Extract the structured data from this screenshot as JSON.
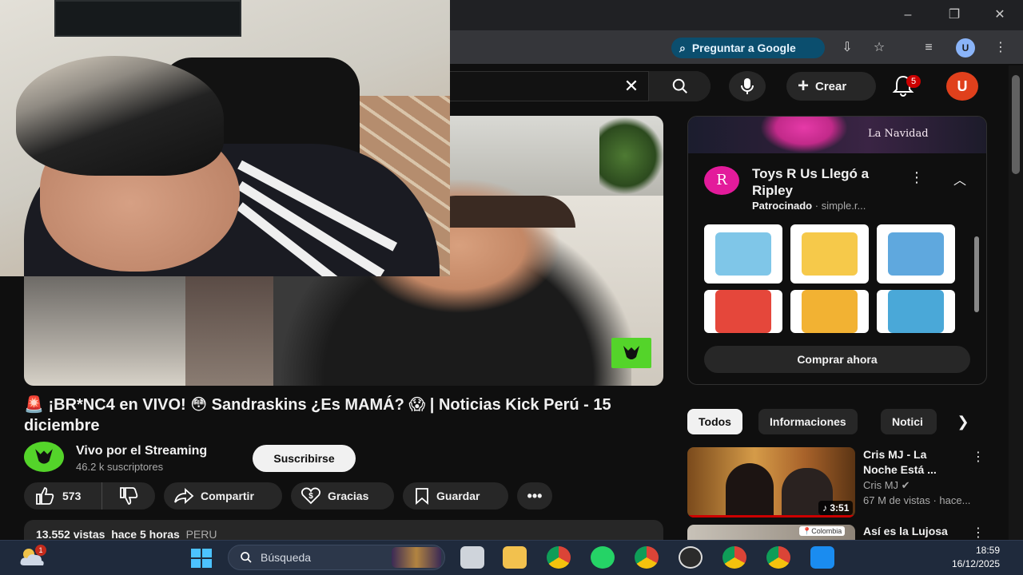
{
  "browser": {
    "omnibox_button": "Preguntar a Google",
    "profile_initial": "U",
    "icons": [
      "minimize-icon",
      "maximize-icon",
      "close-icon",
      "install-icon",
      "star-icon",
      "media-icon",
      "profile-icon",
      "menu-icon"
    ]
  },
  "youtube_header": {
    "create_label": "Crear",
    "notification_count": "5",
    "avatar_initial": "U"
  },
  "video": {
    "title": "🚨 ¡BR*NC4 en VIVO! 😳 Sandraskins ¿Es MAMÁ? 😱 | Noticias Kick Perú - 15 diciembre",
    "channel_name": "Vivo por el Streaming",
    "subscribers": "46.2 k suscriptores",
    "subscribe_label": "Suscribirse",
    "likes": "573",
    "share_label": "Compartir",
    "thanks_label": "Gracias",
    "save_label": "Guardar",
    "views": "13.552 vistas",
    "age": "hace 5 horas",
    "tag": "PERU"
  },
  "ad": {
    "banner_text": "La Navidad",
    "logo_letter": "R",
    "title": "Toys R Us Llegó a Ripley",
    "sponsored_label": "Patrocinado",
    "domain": "simple.r...",
    "cta": "Comprar ahora",
    "product_colors": [
      "#7fc6e8",
      "#f6c94a",
      "#5fa8de",
      "#e5473b",
      "#f2b233",
      "#4aa8d8"
    ]
  },
  "chips": [
    "Todos",
    "Informaciones",
    "Notici"
  ],
  "recommendations": [
    {
      "title": "Cris MJ - La Noche Está ...",
      "channel": "Cris MJ",
      "views": "67 M de vistas",
      "age": "hace...",
      "duration": "3:51"
    },
    {
      "title": "Así es la Lujosa",
      "thumb_tag": "Colombia"
    }
  ],
  "taskbar": {
    "weather_badge": "1",
    "search_placeholder": "Búsqueda",
    "time": "18:59",
    "date": "16/12/2025",
    "apps": [
      "file-explorer-icon",
      "folder-icon",
      "chrome-icon",
      "whatsapp-icon",
      "chrome-profile-icon",
      "obs-icon",
      "chrome-profile-2-icon",
      "chrome-profile-3-icon",
      "phone-link-icon"
    ]
  }
}
